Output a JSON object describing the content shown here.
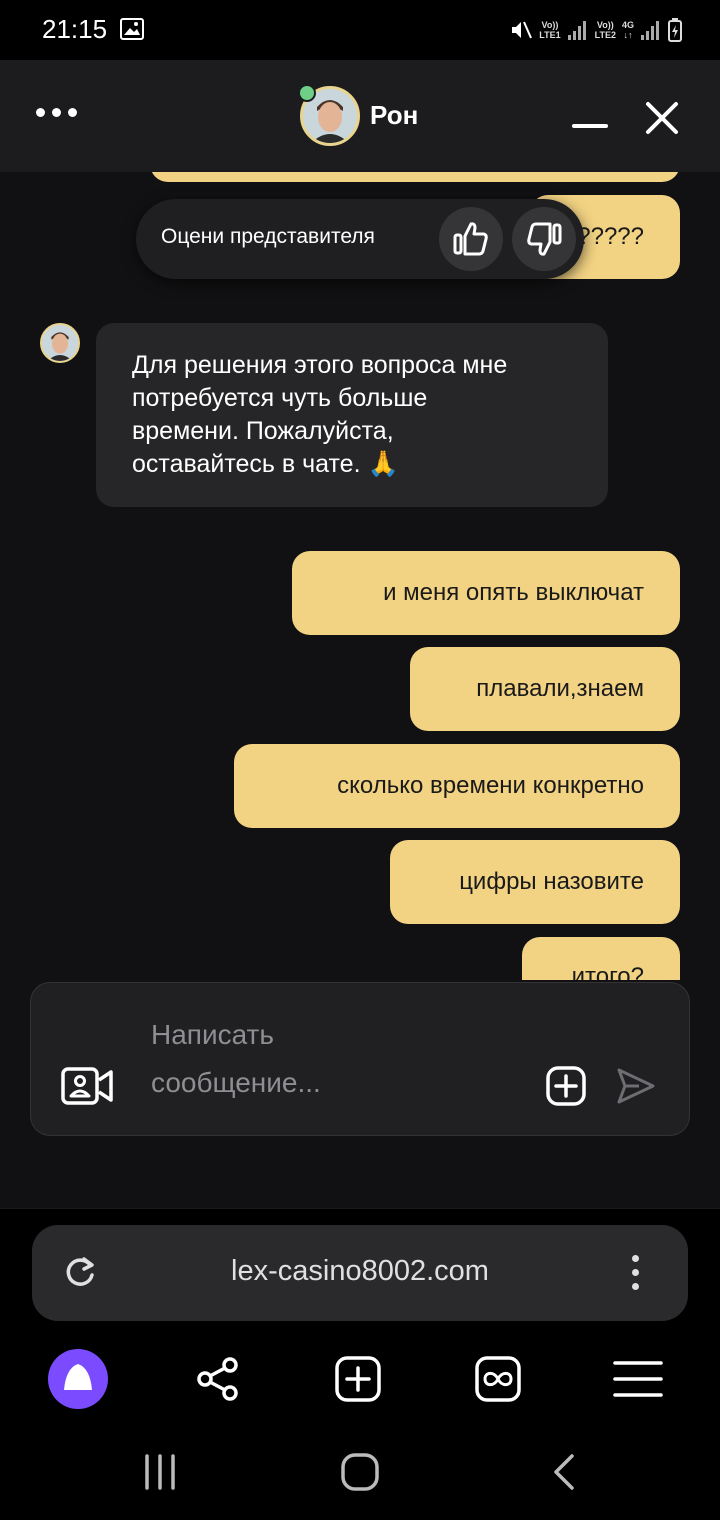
{
  "status_bar": {
    "time": "21:15",
    "sim1": "LTE1",
    "sim2": "LTE2",
    "network": "4G",
    "icons": [
      "gallery-icon",
      "mute-icon",
      "signal-icon",
      "battery-icon"
    ]
  },
  "header": {
    "agent_name": "Рон",
    "menu_icon": "more-dots-icon",
    "minimize_icon": "minimize-icon",
    "close_icon": "close-icon",
    "online": true
  },
  "rating": {
    "label": "Оцени представителя",
    "like_icon": "thumbs-up-icon",
    "dislike_icon": "thumbs-down-icon"
  },
  "messages": {
    "partial_user_text": "?????",
    "agent_text": "Для решения этого вопроса мне потребуется чуть больше времени. Пожалуйста, оставайтесь в чате. 🙏",
    "agent_line1": "Для решения этого вопроса мне",
    "agent_line2": "потребуется чуть больше",
    "agent_line3": "времени. Пожалуйста,",
    "agent_line4": "оставайтесь в чате. 🙏",
    "user": [
      "и меня опять выключат",
      "плавали,знаем",
      "сколько времени конкретно",
      "цифры назовите",
      "итого?"
    ]
  },
  "composer": {
    "placeholder": "Написать сообщение...",
    "placeholder_line1": "Написать",
    "placeholder_line2": "сообщение...",
    "video_icon": "video-call-icon",
    "attach_icon": "add-attachment-icon",
    "send_icon": "send-icon"
  },
  "browser": {
    "url": "lex-casino8002.com",
    "nav": [
      "alice-icon",
      "share-icon",
      "new-tab-icon",
      "tabs-icon",
      "menu-icon"
    ]
  },
  "colors": {
    "user_bubble": "#f2d283",
    "agent_bubble": "#262628",
    "background": "#111113",
    "header": "#1c1c1e",
    "alice_purple": "#7b4cff",
    "online": "#6fcf87"
  }
}
